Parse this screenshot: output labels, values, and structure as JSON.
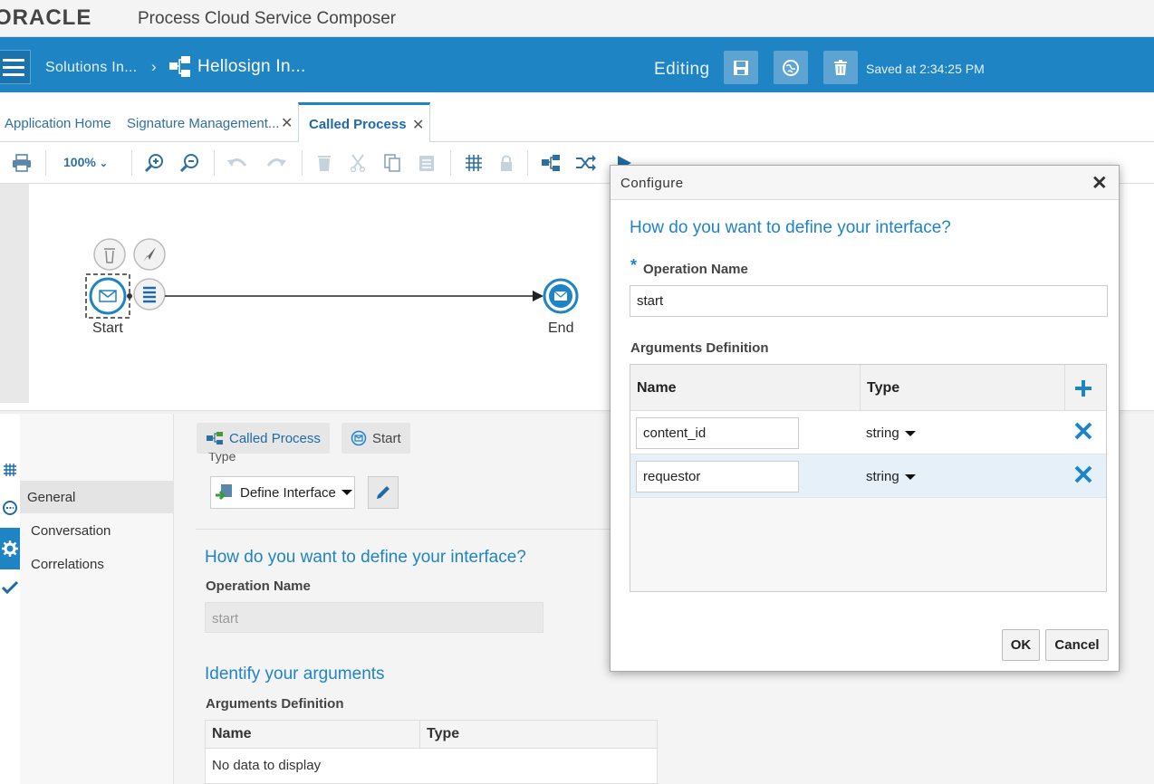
{
  "app": {
    "logo_text": "ORACLE",
    "title": "Process Cloud Service Composer"
  },
  "header": {
    "breadcrumb_parent": "Solutions In...",
    "breadcrumb_sep": "›",
    "breadcrumb_current": "Hellosign In...",
    "mode": "Editing",
    "saved_status": "Saved at 2:34:25 PM"
  },
  "tabs": [
    {
      "label": "Application Home",
      "closable": false
    },
    {
      "label": "Signature Management...",
      "closable": true
    },
    {
      "label": "Called Process",
      "closable": true,
      "active": true
    }
  ],
  "toolbar": {
    "zoom": "100%"
  },
  "canvas": {
    "start_label": "Start",
    "end_label": "End"
  },
  "properties": {
    "breadcrumb": [
      {
        "label": "Called Process",
        "icon": "process-icon"
      },
      {
        "label": "Start",
        "icon": "message-icon"
      }
    ],
    "type_label": "Type",
    "nav": [
      "General",
      "Conversation",
      "Correlations"
    ],
    "active_nav": "General",
    "type_value": "Define Interface",
    "question": "How do you want to define your interface?",
    "operation_label": "Operation Name",
    "operation_value": "start",
    "args_heading": "Identify your arguments",
    "args_label": "Arguments Definition",
    "columns": [
      "Name",
      "Type"
    ],
    "empty_text": "No data to display"
  },
  "dialog": {
    "title": "Configure",
    "question": "How do you want to define your interface?",
    "required_mark": "*",
    "operation_label": "Operation Name",
    "operation_value": "start",
    "args_label": "Arguments Definition",
    "columns": [
      "Name",
      "Type"
    ],
    "rows": [
      {
        "name": "content_id",
        "type": "string"
      },
      {
        "name": "requestor",
        "type": "string"
      }
    ],
    "ok_label": "OK",
    "cancel_label": "Cancel"
  },
  "colors": {
    "accent": "#1f84c4",
    "header_bg": "#1f84c4",
    "delete_x": "#1f84c4"
  }
}
